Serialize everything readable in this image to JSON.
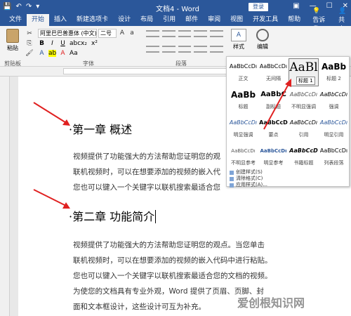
{
  "titlebar": {
    "doc_title": "文档4 - Word",
    "login": "登录"
  },
  "tabs": [
    {
      "label": "文件"
    },
    {
      "label": "开始"
    },
    {
      "label": "插入"
    },
    {
      "label": "新建选项卡"
    },
    {
      "label": "设计"
    },
    {
      "label": "布局"
    },
    {
      "label": "引用"
    },
    {
      "label": "邮件"
    },
    {
      "label": "审阅"
    },
    {
      "label": "视图"
    },
    {
      "label": "开发工具"
    },
    {
      "label": "帮助"
    }
  ],
  "tell_me": "告诉我",
  "share": "共享",
  "ribbon": {
    "paste": "粘贴",
    "font_name": "阿里巴巴普惠体 (中文)",
    "font_size": "二号",
    "styles": "样式",
    "editing": "编辑",
    "groups": {
      "clipboard": "剪贴板",
      "font": "字体",
      "paragraph": "段落"
    }
  },
  "document": {
    "heading1": "第一章 概述",
    "para1": [
      "视频提供了功能强大的方法帮助您证明您的观",
      "联机视频时，可以在想要添加的视频的嵌入代",
      "您也可以键入一个关键字以联机搜索最适合您"
    ],
    "heading2": "第二章 功能简介",
    "para2": [
      "视频提供了功能强大的方法帮助您证明您的观点。当您单击",
      "联机视频时，可以在想要添加的视频的嵌入代码中进行粘贴。",
      "您也可以键入一个关键字以联机搜索最适合您的文档的视频。",
      "为使您的文档具有专业外观，Word 提供了页眉、页脚、封",
      "面和文本框设计，这些设计可互为补充。"
    ]
  },
  "styles_gallery": {
    "items": [
      {
        "sample": "AaBbCcDı",
        "name": "正文"
      },
      {
        "sample": "AaBbCcDı",
        "name": "无间隔"
      },
      {
        "sample": "AaBl",
        "name": "标题 1"
      },
      {
        "sample": "AaBb",
        "name": "标题 2"
      },
      {
        "sample": "AaBb",
        "name": "标题"
      },
      {
        "sample": "AaBbC",
        "name": "副标题"
      },
      {
        "sample": "AaBbCcDı",
        "name": "不明显强调"
      },
      {
        "sample": "AaBbCcDı",
        "name": "强调"
      },
      {
        "sample": "AaBbCcDı",
        "name": "明显强调"
      },
      {
        "sample": "AaBbCcD",
        "name": "要点"
      },
      {
        "sample": "AaBbCcDı",
        "name": "引用"
      },
      {
        "sample": "AaBbCcDı",
        "name": "明显引用"
      },
      {
        "sample": "AaBbCcDı",
        "name": "不明显参考"
      },
      {
        "sample": "AaBbCcDı",
        "name": "明显参考"
      },
      {
        "sample": "AaBbCcD",
        "name": "书籍标题"
      },
      {
        "sample": "AaBbCcDı",
        "name": "列表段落"
      }
    ],
    "tooltip": "标题 1",
    "menu": [
      "创建样式(S)",
      "清除格式(C)",
      "应用样式(A)..."
    ]
  },
  "watermark": "爱创根知识网",
  "colors": {
    "word_blue": "#2b579a",
    "arrow_red": "#e02020"
  }
}
